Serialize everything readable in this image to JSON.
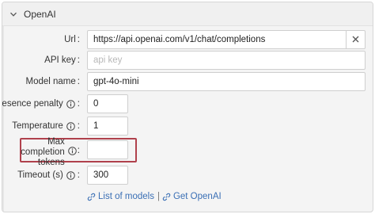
{
  "section": {
    "title": "OpenAI",
    "icon": "chevron-down-icon"
  },
  "fields": {
    "url": {
      "label": "Url",
      "value": "https://api.openai.com/v1/chat/completions",
      "clear_icon": "close-icon"
    },
    "api_key": {
      "label": "API key",
      "placeholder": "api key"
    },
    "model_name": {
      "label": "Model name",
      "value": "gpt-4o-mini"
    },
    "presence_penalty": {
      "label": "Presence penalty",
      "value": "0",
      "info_icon": "info-icon"
    },
    "temperature": {
      "label": "Temperature",
      "value": "1",
      "info_icon": "info-icon"
    },
    "max_completion_tokens": {
      "label_line1": "Max completion",
      "label_line2": "tokens",
      "value": "",
      "info_icon": "info-icon"
    },
    "timeout": {
      "label": "Timeout (s)",
      "value": "300",
      "info_icon": "info-icon"
    }
  },
  "links": {
    "list_of_models": "List of models",
    "separator": "|",
    "get_openai": "Get OpenAI",
    "icon": "link-icon"
  },
  "colors": {
    "highlight": "#b0414c",
    "link": "#3a6fb5"
  }
}
